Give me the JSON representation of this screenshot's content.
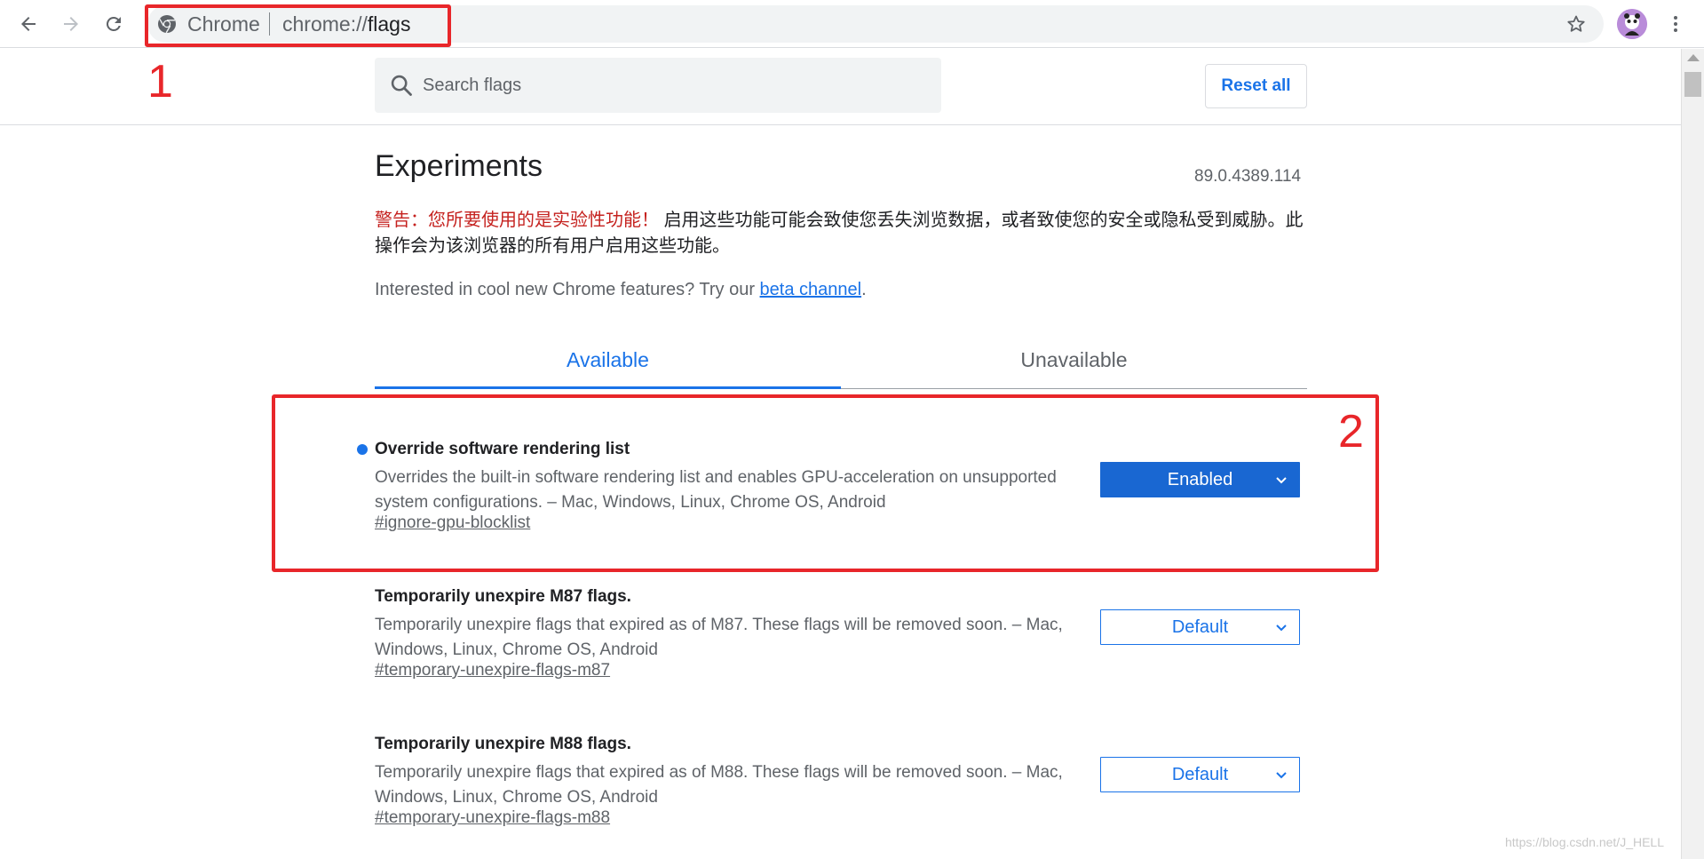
{
  "browser": {
    "omnibox": {
      "origin": "Chrome",
      "url_prefix": "chrome://",
      "url_host": "flags"
    }
  },
  "annotations": {
    "box1_label": "1",
    "box2_label": "2",
    "color": "#e8262a"
  },
  "header": {
    "search_placeholder": "Search flags",
    "reset_label": "Reset all"
  },
  "page": {
    "title": "Experiments",
    "version": "89.0.4389.114",
    "warning_label": "警告：您所要使用的是实验性功能！",
    "warning_text": "启用这些功能可能会致使您丢失浏览数据，或者致使您的安全或隐私受到威胁。此操作会为该浏览器的所有用户启用这些功能。",
    "beta_prefix": "Interested in cool new Chrome features? Try our ",
    "beta_link": "beta channel",
    "beta_suffix": "."
  },
  "tabs": [
    {
      "label": "Available",
      "active": true
    },
    {
      "label": "Unavailable",
      "active": false
    }
  ],
  "flags": [
    {
      "name": "Override software rendering list",
      "description": "Overrides the built-in software rendering list and enables GPU-acceleration on unsupported system configurations. – Mac, Windows, Linux, Chrome OS, Android",
      "link": "#ignore-gpu-blocklist",
      "value": "Enabled",
      "modified": true
    },
    {
      "name": "Temporarily unexpire M87 flags.",
      "description": "Temporarily unexpire flags that expired as of M87. These flags will be removed soon. – Mac, Windows, Linux, Chrome OS, Android",
      "link": "#temporary-unexpire-flags-m87",
      "value": "Default",
      "modified": false
    },
    {
      "name": "Temporarily unexpire M88 flags.",
      "description": "Temporarily unexpire flags that expired as of M88. These flags will be removed soon. – Mac, Windows, Linux, Chrome OS, Android",
      "link": "#temporary-unexpire-flags-m88",
      "value": "Default",
      "modified": false
    }
  ],
  "watermark": "https://blog.csdn.net/J_HELL",
  "colors": {
    "accent": "#1a73e8",
    "enabled_bg": "#1967d2",
    "warning": "#c5221f"
  }
}
